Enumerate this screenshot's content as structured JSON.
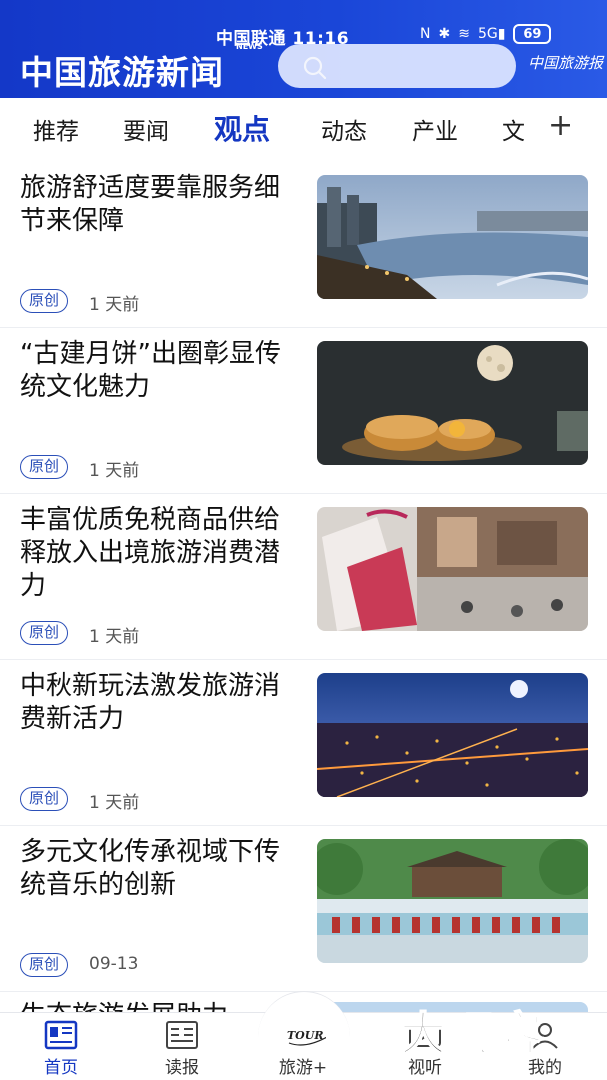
{
  "status_bar": {
    "carrier_time": "中国联通 11:16",
    "battery": "69"
  },
  "header": {
    "logo_text": "中国旅游新闻",
    "logo_news": "NEWS",
    "paper_logo": "中国旅游报"
  },
  "tabs": [
    {
      "label": "推荐"
    },
    {
      "label": "要闻"
    },
    {
      "label": "观点",
      "active": true
    },
    {
      "label": "动态"
    },
    {
      "label": "产业"
    },
    {
      "label": "文"
    }
  ],
  "tabs_add_label": "+",
  "feed": [
    {
      "title": "旅游舒适度要靠服务细节来保障",
      "badge": "原创",
      "time": "1 天前"
    },
    {
      "title": "“古建月饼”出圈彰显传统文化魅力",
      "badge": "原创",
      "time": "1 天前"
    },
    {
      "title": "丰富优质免税商品供给 释放入出境旅游消费潜力",
      "badge": "原创",
      "time": "1 天前"
    },
    {
      "title": "中秋新玩法激发旅游消费新活力",
      "badge": "原创",
      "time": "1 天前"
    },
    {
      "title": "多元文化传承视域下传统音乐的创新",
      "badge": "原创",
      "time": "09-13"
    },
    {
      "title": "生态旅游发展助力"
    }
  ],
  "bottom_nav": [
    {
      "label": "首页",
      "icon": "newspaper-home-icon",
      "active": true
    },
    {
      "label": "读报",
      "icon": "read-paper-icon"
    },
    {
      "label": "旅游+",
      "icon": "tour-logo-icon",
      "icon_text": "TOUR"
    },
    {
      "label": "视听",
      "icon": "video-icon"
    },
    {
      "label": "我的",
      "icon": "profile-icon"
    }
  ],
  "watermark": "大玩客",
  "colors": {
    "brand_blue": "#1437c2",
    "header_blue": "#1a46d8"
  }
}
